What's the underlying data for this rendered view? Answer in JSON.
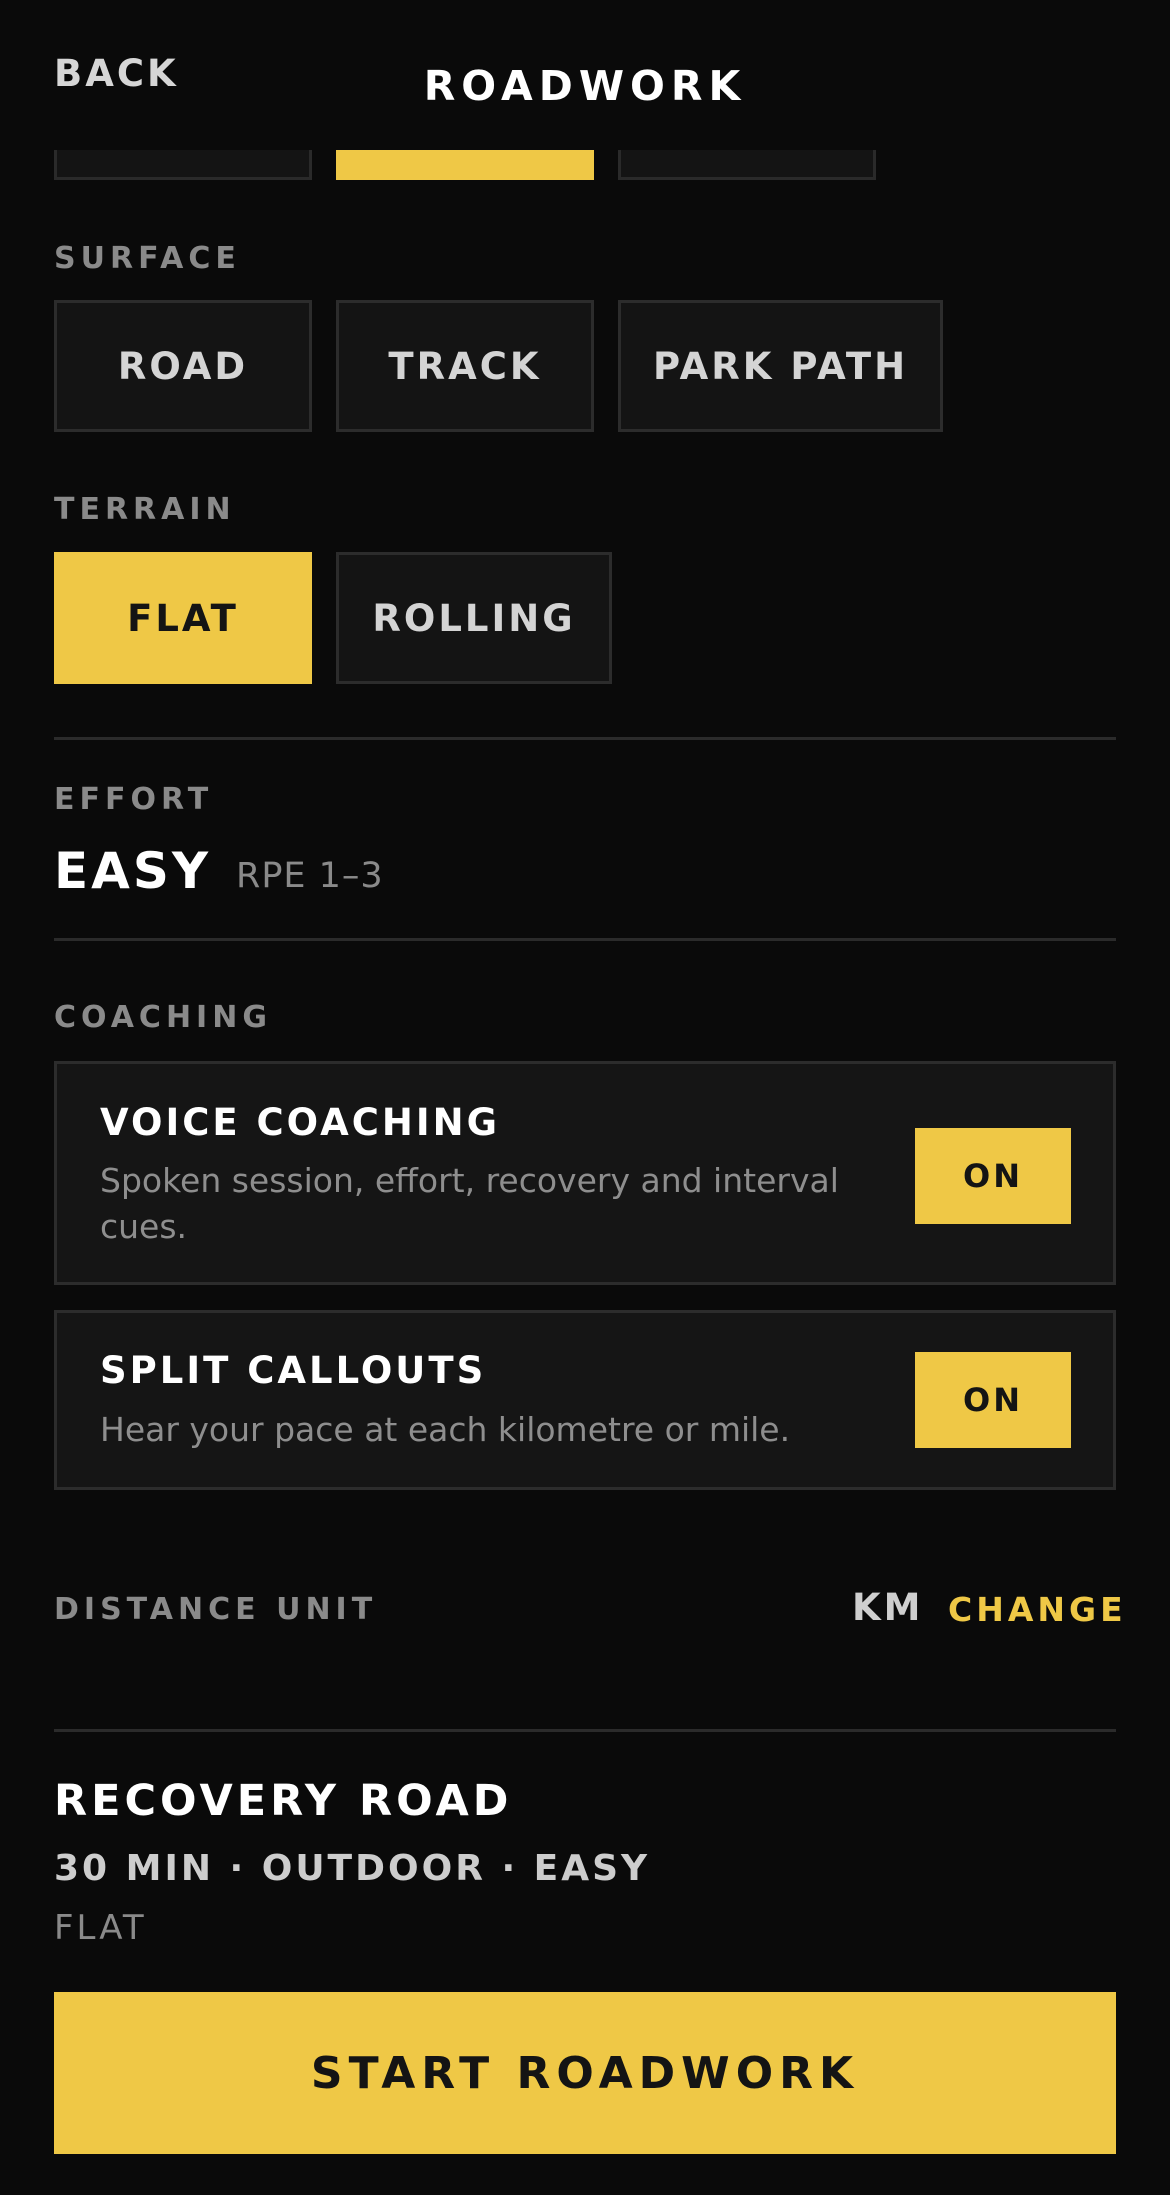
{
  "header": {
    "back_label": "BACK",
    "title": "ROADWORK"
  },
  "surface": {
    "label": "SURFACE",
    "options": [
      "ROAD",
      "TRACK",
      "PARK PATH"
    ]
  },
  "terrain": {
    "label": "TERRAIN",
    "options": [
      "FLAT",
      "ROLLING"
    ],
    "selected": "FLAT"
  },
  "effort": {
    "label": "EFFORT",
    "value": "EASY",
    "scale": "RPE 1–3"
  },
  "coaching": {
    "label": "COACHING",
    "voice": {
      "title": "VOICE COACHING",
      "description": "Spoken session, effort, recovery and interval cues.",
      "state": "ON"
    },
    "splits": {
      "title": "SPLIT CALLOUTS",
      "description": "Hear your pace at each kilometre or mile.",
      "state": "ON"
    }
  },
  "distance_unit": {
    "label": "DISTANCE UNIT",
    "value": "KM",
    "change_label": "CHANGE"
  },
  "summary": {
    "title": "RECOVERY ROAD",
    "meta": "30 MIN · OUTDOOR · EASY",
    "terrain": "FLAT"
  },
  "start_button": "START ROADWORK",
  "colors": {
    "accent": "#efc846",
    "background": "#0a0a0a",
    "card": "#151515"
  }
}
